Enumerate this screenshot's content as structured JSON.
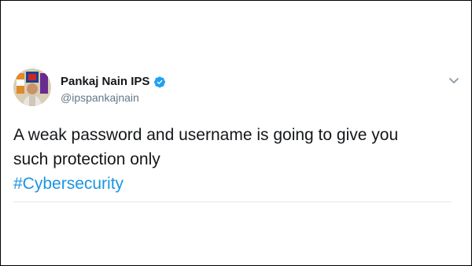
{
  "author": {
    "display_name": "Pankaj Nain IPS",
    "handle": "@ipspankajnain",
    "avatar_icon": "profile-photo"
  },
  "tweet": {
    "line1": "A weak password and username is going to give you",
    "line2": "such protection only",
    "hashtag": "#Cybersecurity"
  },
  "icons": {
    "verified": "verified-badge-icon",
    "menu": "chevron-down-icon"
  },
  "colors": {
    "text": "#14171a",
    "secondary": "#657786",
    "link": "#1b95e0",
    "verified": "#1da1f2"
  }
}
